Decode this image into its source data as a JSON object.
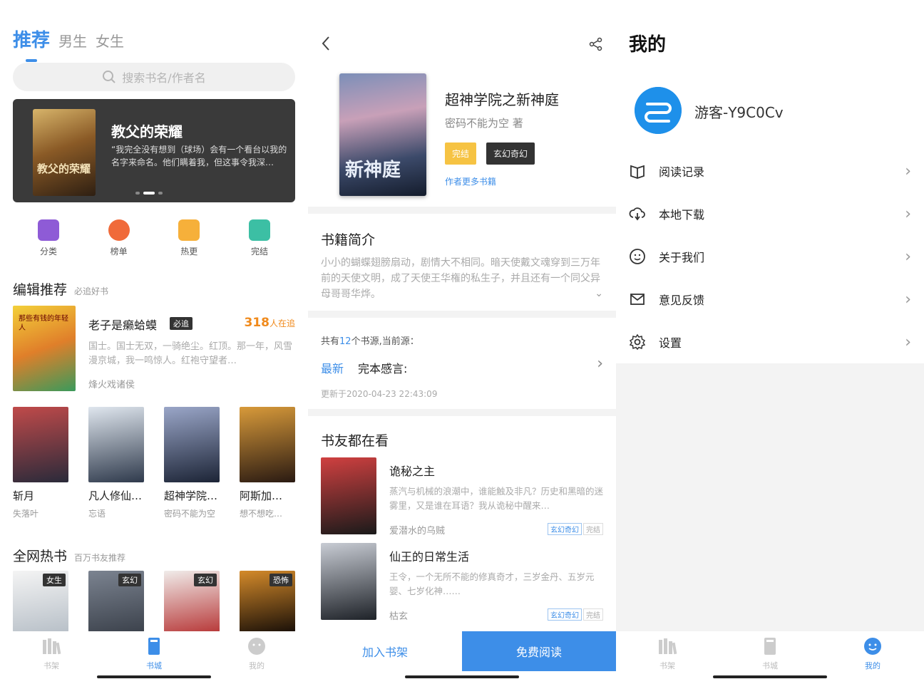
{
  "store": {
    "tabs": {
      "recommend": "推荐",
      "male": "男生",
      "female": "女生"
    },
    "search_placeholder": "搜索书名/作者名",
    "banner": {
      "cover_text": "教父的荣耀",
      "title": "教父的荣耀",
      "desc": "“我完全没有想到（球场）会有一个看台以我的名字来命名。他们瞒着我，但这事令我深…"
    },
    "categories": [
      {
        "label": "分类",
        "icon": "category-icon",
        "color": "#8e5bd6"
      },
      {
        "label": "榜单",
        "icon": "ranking-icon",
        "color": "#f06a3a"
      },
      {
        "label": "热更",
        "icon": "hot-update-icon",
        "color": "#f6b03a"
      },
      {
        "label": "完结",
        "icon": "completed-icon",
        "color": "#3cbfa4"
      }
    ],
    "editor_section": {
      "title": "编辑推荐",
      "sub": "必追好书"
    },
    "featured": {
      "cover_text": "那些有钱的年轻人",
      "title": "老子是癞蛤蟆",
      "tag": "必追",
      "readers": "318",
      "readers_unit": "人在追",
      "desc": "国士。国士无双，一骑绝尘。红顶。那一年，风雪漫京城，我一鸣惊人。红袍守望者…",
      "author": "烽火戏诸侯"
    },
    "grid_books": [
      {
        "title": "斩月",
        "author": "失落叶",
        "color1": "#c04a4a",
        "color2": "#2a2a3a"
      },
      {
        "title": "凡人修仙…",
        "author": "忘语",
        "color1": "#dfe6ee",
        "color2": "#2f3a4c"
      },
      {
        "title": "超神学院…",
        "author": "密码不能为空",
        "color1": "#9aa6c8",
        "color2": "#1c2436"
      },
      {
        "title": "阿斯加…",
        "author": "想不想吃…",
        "color1": "#d89a3a",
        "color2": "#2a1a12"
      }
    ],
    "hot_section": {
      "title": "全网热书",
      "sub": "百万书友推荐"
    },
    "hot_books": [
      {
        "genre": "女生",
        "color1": "#f4f4f4",
        "color2": "#b8c0c8"
      },
      {
        "genre": "玄幻",
        "color1": "#7b8390",
        "color2": "#3c424c"
      },
      {
        "genre": "玄幻",
        "color1": "#f0ecea",
        "color2": "#b83a3a"
      },
      {
        "genre": "恐怖",
        "color1": "#d48a2a",
        "color2": "#1a1008"
      }
    ],
    "tabbar": {
      "shelf": "书架",
      "store": "书城",
      "mine": "我的"
    }
  },
  "detail": {
    "cover_text": "新神庭",
    "title": "超神学院之新神庭",
    "author": "密码不能为空 著",
    "tag_status": "完结",
    "tag_genre": "玄幻奇幻",
    "more_books": "作者更多书籍",
    "intro_title": "书籍简介",
    "intro": "小小的蝴蝶翅膀扇动，剧情大不相同。暗天使戴文魂穿到三万年前的天使文明，成了天使王华権的私生子，并且还有一个同父异母哥哥华烨。",
    "source_prefix": "共有",
    "source_count": "12",
    "source_suffix": "个书源,当前源：",
    "latest_label": "最新",
    "latest_chapter": "完本感言:",
    "updated": "更新于2020-04-23 22:43:09",
    "readers_title": "书友都在看",
    "readers_books": [
      {
        "title": "诡秘之主",
        "desc": "蒸汽与机械的浪潮中，谁能触及非凡？历史和黑暗的迷雾里，又是谁在耳语？我从诡秘中醒来…",
        "author": "爱潜水的乌贼",
        "genre": "玄幻奇幻",
        "status": "完结",
        "color1": "#d04040",
        "color2": "#1a1a1a"
      },
      {
        "title": "仙王的日常生活",
        "desc": "王令，一个无所不能的修真奇才，三岁金丹、五岁元婴、七岁化神……",
        "author": "枯玄",
        "genre": "玄幻奇幻",
        "status": "完结",
        "color1": "#c8ccd4",
        "color2": "#1e2228"
      }
    ],
    "add_shelf": "加入书架",
    "free_read": "免费阅读"
  },
  "mine": {
    "title": "我的",
    "username": "游客-Y9C0Cv",
    "menu": [
      {
        "label": "阅读记录",
        "icon": "book-icon"
      },
      {
        "label": "本地下载",
        "icon": "download-icon"
      },
      {
        "label": "关于我们",
        "icon": "smile-icon"
      },
      {
        "label": "意见反馈",
        "icon": "mail-icon"
      },
      {
        "label": "设置",
        "icon": "gear-icon"
      }
    ],
    "tabbar": {
      "shelf": "书架",
      "store": "书城",
      "mine": "我的"
    }
  },
  "colors": {
    "accent": "#3d8ee8",
    "hot": "#f08a1c",
    "tag_yellow": "#f6c343"
  }
}
